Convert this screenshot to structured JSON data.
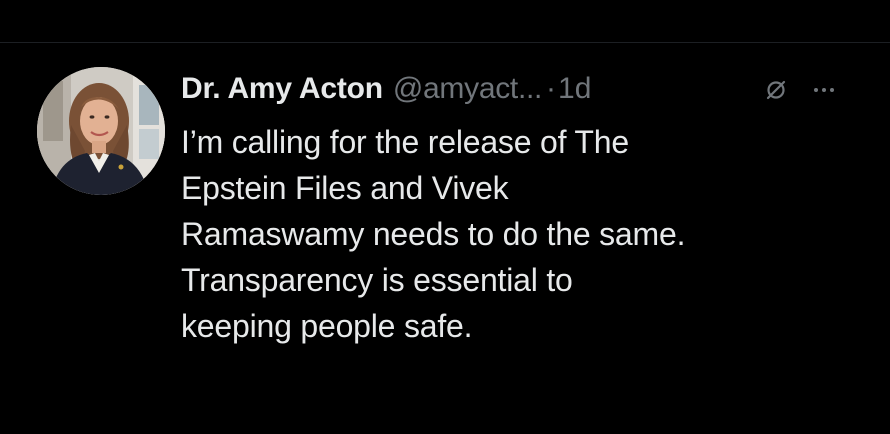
{
  "tweet": {
    "author": {
      "display_name": "Dr. Amy Acton",
      "handle": "@amyact...",
      "avatar_icon": "profile-photo"
    },
    "separator": "·",
    "time": "1d",
    "grok_icon": "grok-icon",
    "more_icon": "more-horizontal-icon",
    "text_lines": [
      "I’m calling for the release of The",
      "Epstein Files and Vivek",
      "Ramaswamy needs to do the same.",
      "Transparency is essential to",
      "keeping people safe."
    ]
  },
  "colors": {
    "background": "#000000",
    "primary_text": "#e7e9ea",
    "secondary_text": "#71767b"
  }
}
